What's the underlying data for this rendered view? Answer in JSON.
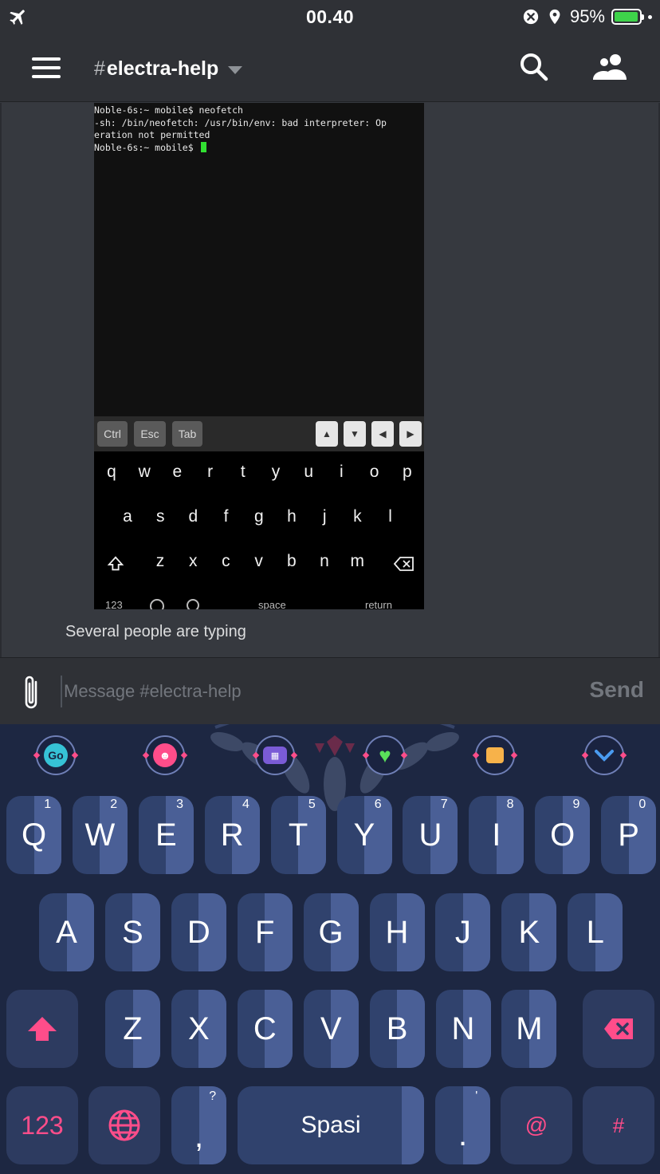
{
  "status_bar": {
    "time": "00.40",
    "battery_percent": "95%",
    "battery_level": 0.95,
    "icons": [
      "airplane-icon",
      "close-circle-icon",
      "location-icon",
      "battery-icon"
    ]
  },
  "header": {
    "hash": "#",
    "channel_name": "electra-help",
    "icons": [
      "menu-icon",
      "chevron-down-icon",
      "search-icon",
      "members-icon"
    ]
  },
  "chat": {
    "terminal_lines": [
      "Noble-6s:~ mobile$ neofetch",
      "-sh: /bin/neofetch: /usr/bin/env: bad interpreter: Op",
      "eration not permitted",
      "Noble-6s:~ mobile$ "
    ],
    "terminal_toolbar": {
      "keys": [
        "Ctrl",
        "Esc",
        "Tab"
      ],
      "arrows": [
        "▲",
        "▼",
        "◀",
        "▶"
      ]
    },
    "terminal_keyboard": {
      "row1": [
        "q",
        "w",
        "e",
        "r",
        "t",
        "y",
        "u",
        "i",
        "o",
        "p"
      ],
      "row2": [
        "a",
        "s",
        "d",
        "f",
        "g",
        "h",
        "j",
        "k",
        "l"
      ],
      "row3": [
        "z",
        "x",
        "c",
        "v",
        "b",
        "n",
        "m"
      ],
      "bottom": [
        "123",
        "space",
        "return"
      ]
    },
    "typing_indicator": "Several people are typing"
  },
  "composer": {
    "placeholder": "Message #electra-help",
    "value": "",
    "send_label": "Send"
  },
  "keyboard": {
    "toolbar_icons": [
      "go-icon",
      "emoji-icon",
      "keyboard-icon",
      "heart-icon",
      "shirt-icon",
      "chevron-down-icon"
    ],
    "row1": [
      {
        "label": "Q",
        "hint": "1"
      },
      {
        "label": "W",
        "hint": "2"
      },
      {
        "label": "E",
        "hint": "3"
      },
      {
        "label": "R",
        "hint": "4"
      },
      {
        "label": "T",
        "hint": "5"
      },
      {
        "label": "Y",
        "hint": "6"
      },
      {
        "label": "U",
        "hint": "7"
      },
      {
        "label": "I",
        "hint": "8"
      },
      {
        "label": "O",
        "hint": "9"
      },
      {
        "label": "P",
        "hint": "0"
      }
    ],
    "row2": [
      "A",
      "S",
      "D",
      "F",
      "G",
      "H",
      "J",
      "K",
      "L"
    ],
    "row3": [
      "Z",
      "X",
      "C",
      "V",
      "B",
      "N",
      "M"
    ],
    "bottom": {
      "numbers": "123",
      "comma": ",",
      "comma_hint": "?",
      "space": "Spasi",
      "period": ".",
      "period_hint": "'",
      "at": "@",
      "hash": "#"
    },
    "accent_color": "#ff4d8a",
    "background_color": "#1d2742"
  }
}
